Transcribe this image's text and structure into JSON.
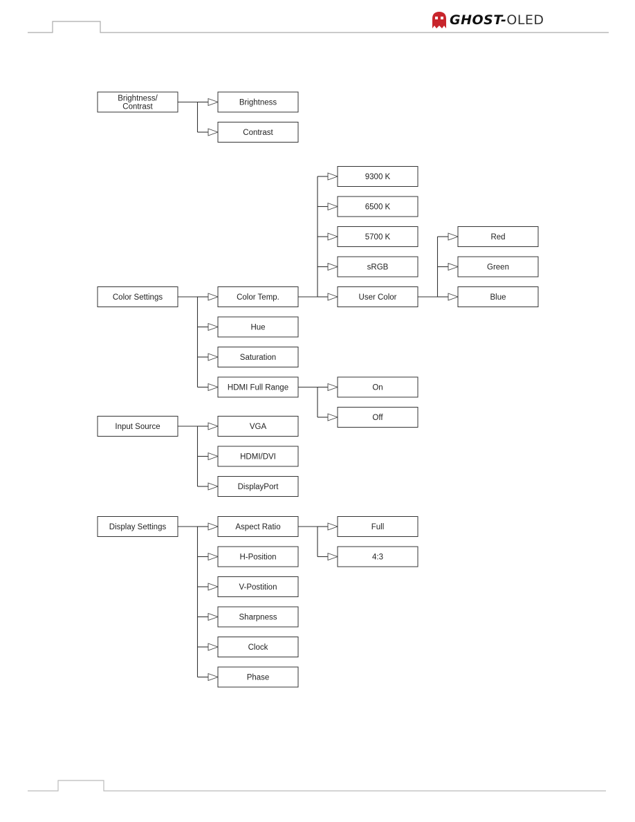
{
  "header": {
    "logo_main": "GHOST-",
    "logo_sub": "OLED",
    "logo_color": "#c8252c"
  },
  "diagram": {
    "groups": [
      {
        "id": "brightness-contrast",
        "label": "Brightness/\nContrast",
        "label_lines": [
          "Brightness/",
          "Contrast"
        ],
        "children": [
          {
            "label": "Brightness"
          },
          {
            "label": "Contrast"
          }
        ]
      },
      {
        "id": "color-settings",
        "label": "Color Settings",
        "children": [
          {
            "label": "Color Temp.",
            "children": [
              {
                "label": "9300 K"
              },
              {
                "label": "6500 K"
              },
              {
                "label": "5700 K"
              },
              {
                "label": "sRGB"
              },
              {
                "label": "User Color",
                "children": [
                  {
                    "label": "Red"
                  },
                  {
                    "label": "Green"
                  },
                  {
                    "label": "Blue"
                  }
                ]
              }
            ]
          },
          {
            "label": "Hue"
          },
          {
            "label": "Saturation"
          },
          {
            "label": "HDMI Full Range",
            "children": [
              {
                "label": "On"
              },
              {
                "label": "Off"
              }
            ]
          }
        ]
      },
      {
        "id": "input-source",
        "label": "Input Source",
        "children": [
          {
            "label": "VGA"
          },
          {
            "label": "HDMI/DVI"
          },
          {
            "label": "DisplayPort"
          }
        ]
      },
      {
        "id": "display-settings",
        "label": "Display Settings",
        "children": [
          {
            "label": "Aspect Ratio",
            "children": [
              {
                "label": "Full"
              },
              {
                "label": "4:3"
              }
            ]
          },
          {
            "label": "H-Position"
          },
          {
            "label": "V-Postition"
          },
          {
            "label": "Sharpness"
          },
          {
            "label": "Clock"
          },
          {
            "label": "Phase"
          }
        ]
      }
    ]
  }
}
